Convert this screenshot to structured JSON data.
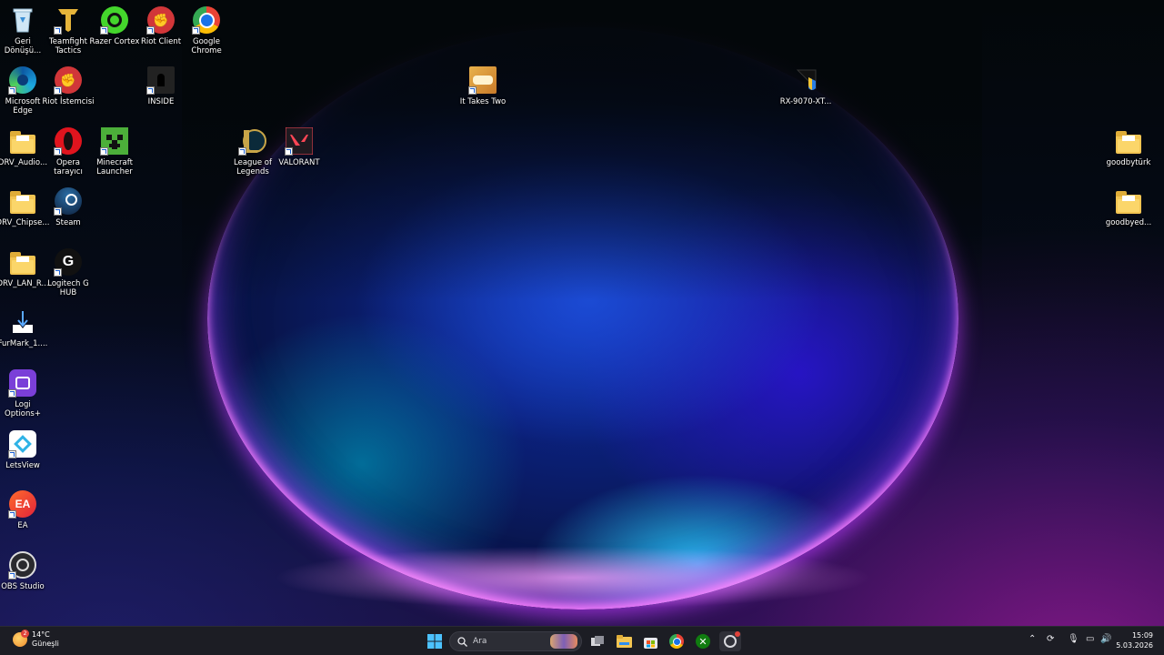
{
  "desktop": {
    "icons": [
      {
        "label": "Geri Dönüşü...",
        "icon": "recycle-bin-icon"
      },
      {
        "label": "Teamfight Tactics",
        "icon": "teamfight-tactics-icon"
      },
      {
        "label": "Razer Cortex",
        "icon": "razer-cortex-icon"
      },
      {
        "label": "Riot Client",
        "icon": "riot-client-icon"
      },
      {
        "label": "Google Chrome",
        "icon": "chrome-icon"
      },
      {
        "label": "Microsoft Edge",
        "icon": "edge-icon"
      },
      {
        "label": "Riot İstemcisi",
        "icon": "riot-client-icon"
      },
      {
        "label": "INSIDE",
        "icon": "inside-game-icon"
      },
      {
        "label": "It Takes Two",
        "icon": "it-takes-two-icon"
      },
      {
        "label": "RX-9070-XT...",
        "icon": "amd-installer-icon"
      },
      {
        "label": "DRV_Audio...",
        "icon": "folder-icon"
      },
      {
        "label": "Opera tarayıcı",
        "icon": "opera-icon"
      },
      {
        "label": "Minecraft Launcher",
        "icon": "minecraft-icon"
      },
      {
        "label": "League of Legends",
        "icon": "league-of-legends-icon"
      },
      {
        "label": "VALORANT",
        "icon": "valorant-icon"
      },
      {
        "label": "goodbytürk",
        "icon": "folder-icon"
      },
      {
        "label": "DRV_Chipse...",
        "icon": "folder-icon"
      },
      {
        "label": "Steam",
        "icon": "steam-icon"
      },
      {
        "label": "goodbyed...",
        "icon": "folder-icon"
      },
      {
        "label": "DRV_LAN_R...",
        "icon": "folder-icon"
      },
      {
        "label": "Logitech G HUB",
        "icon": "logitech-g-icon"
      },
      {
        "label": "FurMark_1....",
        "icon": "download-icon"
      },
      {
        "label": "Logi Options+",
        "icon": "logi-options-icon"
      },
      {
        "label": "LetsView",
        "icon": "letsview-icon"
      },
      {
        "label": "EA",
        "icon": "ea-icon"
      },
      {
        "label": "OBS Studio",
        "icon": "obs-icon"
      }
    ]
  },
  "taskbar": {
    "weather": {
      "temp": "14°C",
      "condition": "Güneşli",
      "badge": "2"
    },
    "search_placeholder": "Ara",
    "pinned": [
      "start-icon",
      "search-icon",
      "task-view-icon",
      "file-explorer-icon",
      "microsoft-store-icon",
      "chrome-icon",
      "xbox-icon",
      "gaming-app-icon"
    ],
    "tray": [
      "chevron-up-icon",
      "sync-icon",
      "microphone-icon",
      "display-icon",
      "speaker-icon"
    ],
    "clock": {
      "time": "15:09",
      "date": "5.03.2026"
    }
  },
  "colors": {
    "taskbar": "#1c1d24",
    "folder": "#f3c552",
    "accent": "#1a5fd0"
  }
}
